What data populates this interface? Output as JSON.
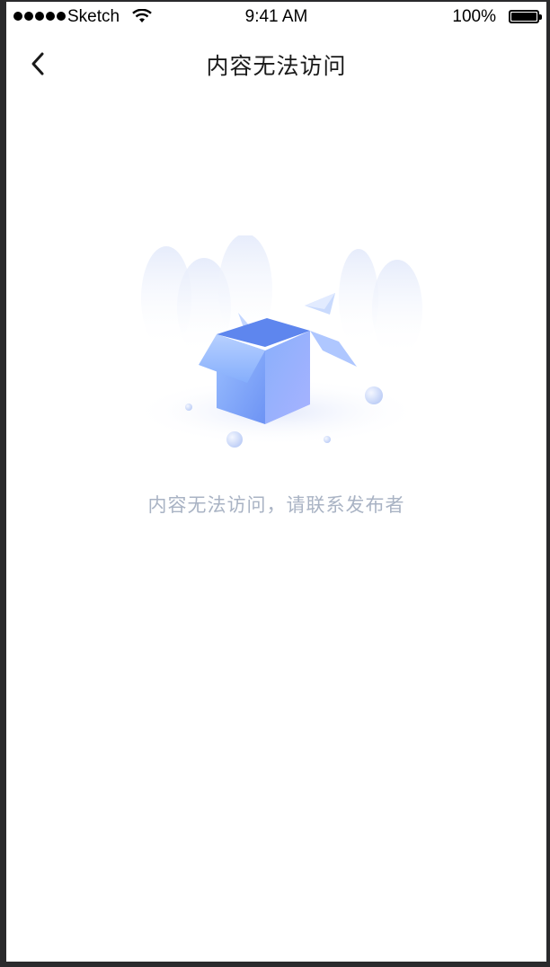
{
  "status_bar": {
    "carrier": "Sketch",
    "time": "9:41 AM",
    "battery": "100%",
    "signal_icon": "signal-dots-icon",
    "wifi_icon": "wifi-icon",
    "battery_icon": "battery-icon"
  },
  "nav": {
    "title": "内容无法访问",
    "back_icon": "chevron-left-icon"
  },
  "main": {
    "empty_message": "内容无法访问，请联系发布者",
    "illustration_icon": "empty-box-icon"
  },
  "colors": {
    "background": "#ffffff",
    "title": "#1a1a1a",
    "message": "#a9b3c4",
    "box_blue": "#7aa6fb"
  }
}
